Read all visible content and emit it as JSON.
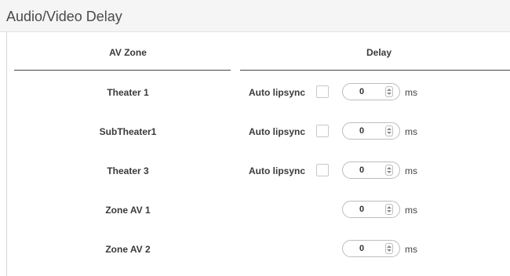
{
  "panel": {
    "title": "Audio/Video Delay"
  },
  "table": {
    "headers": {
      "zone": "AV Zone",
      "delay": "Delay"
    },
    "unit": "ms",
    "auto_label": "Auto lipsync",
    "rows": [
      {
        "zone": "Theater 1",
        "auto_lipsync": true,
        "checked": false,
        "delay": "0"
      },
      {
        "zone": "SubTheater1",
        "auto_lipsync": true,
        "checked": false,
        "delay": "0"
      },
      {
        "zone": "Theater 3",
        "auto_lipsync": true,
        "checked": false,
        "delay": "0"
      },
      {
        "zone": "Zone AV 1",
        "auto_lipsync": false,
        "checked": false,
        "delay": "0"
      },
      {
        "zone": "Zone AV 2",
        "auto_lipsync": false,
        "checked": false,
        "delay": "0"
      }
    ]
  }
}
